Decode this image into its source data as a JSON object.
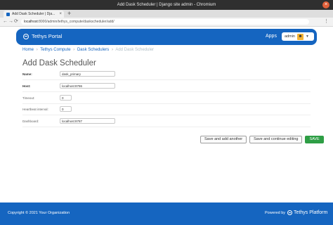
{
  "window": {
    "title": "Add Dask Scheduler | Django site admin - Chromium",
    "close_glyph": "×"
  },
  "browser": {
    "tab_title": "Add Dask Scheduler | Dja...",
    "tab_close": "×",
    "new_tab": "+",
    "back": "←",
    "forward": "→",
    "reload": "⟳",
    "url_host": "localhost",
    "url_path": ":8000/admin/tethys_compute/daskscheduler/add/",
    "menu": "⋮"
  },
  "navbar": {
    "brand": "Tethys Portal",
    "apps_label": "Apps",
    "user": "admin",
    "avatar_glyph": "☻",
    "caret": "▼"
  },
  "breadcrumb": {
    "home": "Home",
    "app": "Tethys Compute",
    "model": "Dask Schedulers",
    "current": "Add Dask Scheduler",
    "sep": "›"
  },
  "page": {
    "title": "Add Dask Scheduler"
  },
  "form": {
    "fields": [
      {
        "label": "Name:",
        "value": "dask_primary",
        "required": true
      },
      {
        "label": "Host:",
        "value": "localhost:8786",
        "required": true
      },
      {
        "label": "Timeout:",
        "value": "0",
        "required": false
      },
      {
        "label": "Heartbeat interval:",
        "value": "0",
        "required": false
      },
      {
        "label": "Dashboard:",
        "value": "localhost:8787",
        "required": false
      }
    ],
    "buttons": {
      "save_add_another": "Save and add another",
      "save_continue": "Save and continue editing",
      "save": "SAVE"
    }
  },
  "footer": {
    "copyright": "Copyright © 2021 Your Organization",
    "powered_by": "Powered by",
    "platform": "Tethys Platform"
  },
  "colors": {
    "brand": "#1565c0",
    "save": "#2e9e45",
    "chrome_title": "#2f2f2f"
  }
}
